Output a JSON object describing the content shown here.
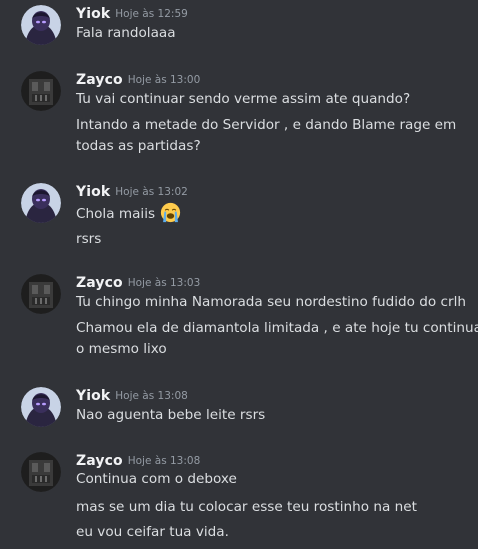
{
  "messages": [
    {
      "username": "Yiok",
      "timestamp": "Hoje às 12:59",
      "avatar": "yiok-avatar",
      "lines": [
        "Fala randolaaa"
      ]
    },
    {
      "username": "Zayco",
      "timestamp": "Hoje às 13:00",
      "avatar": "zayco-avatar",
      "lines": [
        "Tu vai continuar sendo verme assim ate quando?",
        "Intando a metade do Servidor , e dando Blame rage em",
        "todas as partidas?"
      ]
    },
    {
      "username": "Yiok",
      "timestamp": "Hoje às 13:02",
      "avatar": "yiok-avatar",
      "lines": [
        "Chola maiis",
        "rsrs"
      ],
      "emoji": "loudly-crying-face-icon"
    },
    {
      "username": "Zayco",
      "timestamp": "Hoje às 13:03",
      "avatar": "zayco-avatar",
      "lines": [
        "Tu chingo minha Namorada seu nordestino fudido do crlh",
        "Chamou ela de diamantola limitada , e ate hoje tu continua",
        "o mesmo lixo"
      ]
    },
    {
      "username": "Yiok",
      "timestamp": "Hoje às 13:08",
      "avatar": "yiok-avatar",
      "lines": [
        "Nao aguenta bebe leite rsrs"
      ]
    },
    {
      "username": "Zayco",
      "timestamp": "Hoje às 13:08",
      "avatar": "zayco-avatar",
      "lines": [
        "Continua com o deboxe",
        "mas se um dia tu colocar esse teu rostinho na net",
        "eu vou ceifar tua vida."
      ]
    }
  ],
  "colors": {
    "background": "#313338",
    "username": "#f2f3f5",
    "timestamp": "#949ba4",
    "text": "#dbdee1"
  }
}
